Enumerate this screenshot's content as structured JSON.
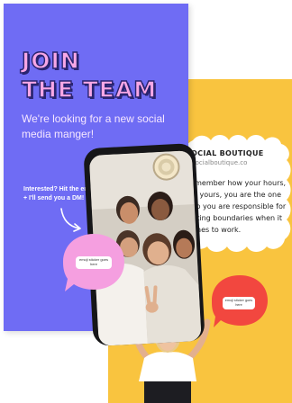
{
  "front_card": {
    "headline_line1": "JOIN",
    "headline_line2": "THE TEAM",
    "subline": "We're looking for a new social media manger!",
    "prompt": "Interested? Hit the emoji + I'll send you a DM!",
    "sticker_label": "emoji sticker goes here",
    "colors": {
      "background": "#6f6cf4",
      "headline": "#f7a7e6",
      "headline_outline": "#2a2470",
      "sticker": "#f59fe0"
    }
  },
  "back_card": {
    "brand_name": "SOCIAL BOUTIQUE",
    "brand_handle": "@socialboutique.co",
    "body_text": "Remember how your hours, are yours, you are the one who you are responsible for setting boundaries when it comes to work.",
    "sticker_label": "emoji sticker goes here",
    "colors": {
      "background": "#f9c43f",
      "cloud": "#ffffff",
      "sticker": "#f2473f"
    }
  },
  "icons": {
    "arrow": "curved-arrow-icon",
    "camera": "camera-ring-icon"
  }
}
